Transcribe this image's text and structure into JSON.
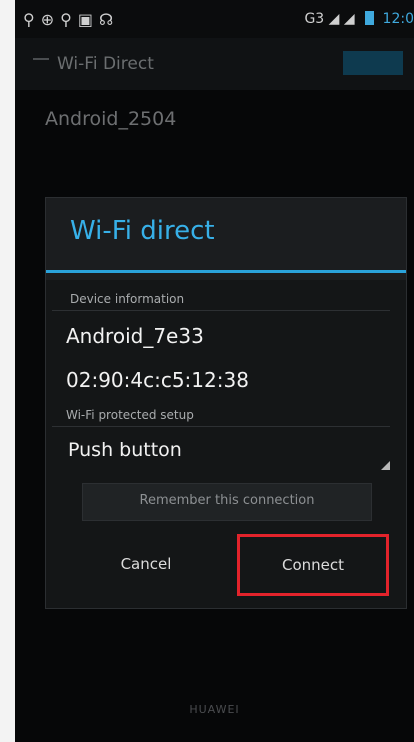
{
  "status_bar": {
    "left_icons": [
      "usb-icon",
      "android-icon",
      "usb-icon",
      "image-icon",
      "sync-icon"
    ],
    "right_indicators": "G3 ◢ ◢",
    "time": "12:0"
  },
  "background": {
    "action_title": "Wi-Fi Direct",
    "search_label": "",
    "device_name": "Android_2504",
    "device_sub": "",
    "section_label": ""
  },
  "dialog": {
    "title": "Wi-Fi direct",
    "device_info_label": "Device information",
    "device_name": "Android_7e33",
    "mac_address": "02:90:4c:c5:12:38",
    "wps_label": "Wi-Fi protected setup",
    "wps_value": "Push button",
    "remember_label": "Remember this connection",
    "cancel_label": "Cancel",
    "connect_label": "Connect"
  },
  "brand": "HUAWEI",
  "colors": {
    "accent": "#2aa3db",
    "highlight_box": "#e2232b"
  }
}
